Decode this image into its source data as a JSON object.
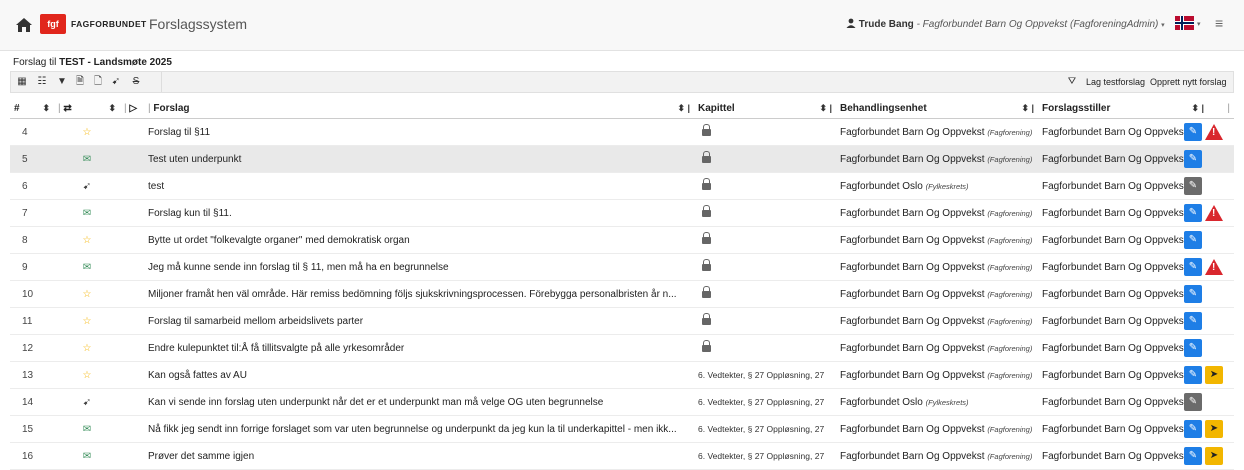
{
  "header": {
    "brand": "FAGFORBUNDET",
    "logo_text": "fgf",
    "app_title": "Forslagssystem",
    "user_name": "Trude Bang",
    "user_role": " - Fagforbundet Barn Og Oppvekst (FagforeningAdmin)",
    "user_caret": "▾",
    "flag_caret": "▾",
    "icons": [
      "home-icon",
      "user-icon",
      "norway-flag-icon",
      "hamburger-icon"
    ]
  },
  "breadcrumb": {
    "prefix": "Forslag til ",
    "title": "TEST - Landsmøte 2025"
  },
  "toolbar": {
    "icons": [
      "grid-icon",
      "list-icon",
      "filter-icon",
      "pdf-icon",
      "word-icon",
      "send-icon",
      "strikethrough-icon"
    ],
    "clear_filter_icon": "filter-clear-icon",
    "test_button": "Lag testforslag",
    "create_button": "Opprett nytt forslag"
  },
  "table": {
    "columns": {
      "num": "#",
      "forslag": "Forslag",
      "kapittel": "Kapittel",
      "behandlingsenhet": "Behandlingsenhet",
      "forslagsstiller": "Forslagsstiller"
    },
    "rows": [
      {
        "num": "4",
        "status": "star",
        "title": "Forslag til §11",
        "kapittel": "",
        "locked": true,
        "beh": "Fagforbundet Barn Og Oppvekst",
        "beh_type": "(Fagforening)",
        "stiller": "Fagforbundet Barn Og Oppvekst",
        "edit": "blue",
        "send": false,
        "warn": true
      },
      {
        "num": "5",
        "status": "envelope",
        "title": "Test uten underpunkt",
        "kapittel": "",
        "locked": true,
        "beh": "Fagforbundet Barn Og Oppvekst",
        "beh_type": "(Fagforening)",
        "stiller": "Fagforbundet Barn Og Oppvekst",
        "edit": "blue",
        "send": false,
        "warn": false,
        "highlight": true
      },
      {
        "num": "6",
        "status": "send",
        "title": "test",
        "kapittel": "",
        "locked": true,
        "beh": "Fagforbundet Oslo",
        "beh_type": "(Fylkeskrets)",
        "stiller": "Fagforbundet Barn Og Oppvekst",
        "edit": "gray",
        "send": false,
        "warn": false
      },
      {
        "num": "7",
        "status": "envelope",
        "title": "Forslag kun til §11.",
        "kapittel": "",
        "locked": true,
        "beh": "Fagforbundet Barn Og Oppvekst",
        "beh_type": "(Fagforening)",
        "stiller": "Fagforbundet Barn Og Oppvekst",
        "edit": "blue",
        "send": false,
        "warn": true
      },
      {
        "num": "8",
        "status": "star",
        "title": "Bytte ut ordet \"folkevalgte organer\" med demokratisk organ",
        "kapittel": "",
        "locked": true,
        "beh": "Fagforbundet Barn Og Oppvekst",
        "beh_type": "(Fagforening)",
        "stiller": "Fagforbundet Barn Og Oppvekst",
        "edit": "blue",
        "send": false,
        "warn": false
      },
      {
        "num": "9",
        "status": "envelope",
        "title": "Jeg må kunne sende inn forslag til § 11, men må ha en begrunnelse",
        "kapittel": "",
        "locked": true,
        "beh": "Fagforbundet Barn Og Oppvekst",
        "beh_type": "(Fagforening)",
        "stiller": "Fagforbundet Barn Og Oppvekst",
        "edit": "blue",
        "send": false,
        "warn": true
      },
      {
        "num": "10",
        "status": "star",
        "title": "Miljoner framåt hen väl område. Här remiss bedömning följs sjukskrivningsprocessen. Förebygga personalbristen år n...",
        "kapittel": "",
        "locked": true,
        "beh": "Fagforbundet Barn Og Oppvekst",
        "beh_type": "(Fagforening)",
        "stiller": "Fagforbundet Barn Og Oppvekst",
        "edit": "blue",
        "send": false,
        "warn": false
      },
      {
        "num": "11",
        "status": "star",
        "title": "Forslag til samarbeid mellom arbeidslivets parter",
        "kapittel": "",
        "locked": true,
        "beh": "Fagforbundet Barn Og Oppvekst",
        "beh_type": "(Fagforening)",
        "stiller": "Fagforbundet Barn Og Oppvekst",
        "edit": "blue",
        "send": false,
        "warn": false
      },
      {
        "num": "12",
        "status": "star",
        "title": "Endre kulepunktet til:Å få tillitsvalgte på alle yrkesområder",
        "kapittel": "",
        "locked": true,
        "beh": "Fagforbundet Barn Og Oppvekst",
        "beh_type": "(Fagforening)",
        "stiller": "Fagforbundet Barn Og Oppvekst",
        "edit": "blue",
        "send": false,
        "warn": false
      },
      {
        "num": "13",
        "status": "star",
        "title": "Kan også fattes av AU",
        "kapittel": "6. Vedtekter, § 27 Oppløsning, 27",
        "locked": false,
        "beh": "Fagforbundet Barn Og Oppvekst",
        "beh_type": "(Fagforening)",
        "stiller": "Fagforbundet Barn Og Oppvekst",
        "edit": "blue",
        "send": true,
        "warn": false
      },
      {
        "num": "14",
        "status": "send",
        "title": "Kan vi sende inn forslag uten underpunkt når det er et underpunkt man må velge OG uten begrunnelse",
        "kapittel": "6. Vedtekter, § 27 Oppløsning, 27",
        "locked": false,
        "beh": "Fagforbundet Oslo",
        "beh_type": "(Fylkeskrets)",
        "stiller": "Fagforbundet Barn Og Oppvekst",
        "edit": "gray",
        "send": false,
        "warn": false
      },
      {
        "num": "15",
        "status": "envelope",
        "title": "Nå fikk jeg sendt inn forrige forslaget som var uten begrunnelse og underpunkt da jeg kun la til underkapittel - men ikk...",
        "kapittel": "6. Vedtekter, § 27 Oppløsning, 27",
        "locked": false,
        "beh": "Fagforbundet Barn Og Oppvekst",
        "beh_type": "(Fagforening)",
        "stiller": "Fagforbundet Barn Og Oppvekst",
        "edit": "blue",
        "send": true,
        "warn": false
      },
      {
        "num": "16",
        "status": "envelope",
        "title": "Prøver det samme igjen",
        "kapittel": "6. Vedtekter, § 27 Oppløsning, 27",
        "locked": false,
        "beh": "Fagforbundet Barn Og Oppvekst",
        "beh_type": "(Fagforening)",
        "stiller": "Fagforbundet Barn Og Oppvekst",
        "edit": "blue",
        "send": true,
        "warn": false
      }
    ]
  },
  "colors": {
    "edit_blue": "#1e7ee6",
    "edit_gray": "#6b6b6b",
    "send_yellow": "#f2b600",
    "warn_red": "#d9272e",
    "star": "#f5b400",
    "envelope": "#3a8f5c"
  }
}
